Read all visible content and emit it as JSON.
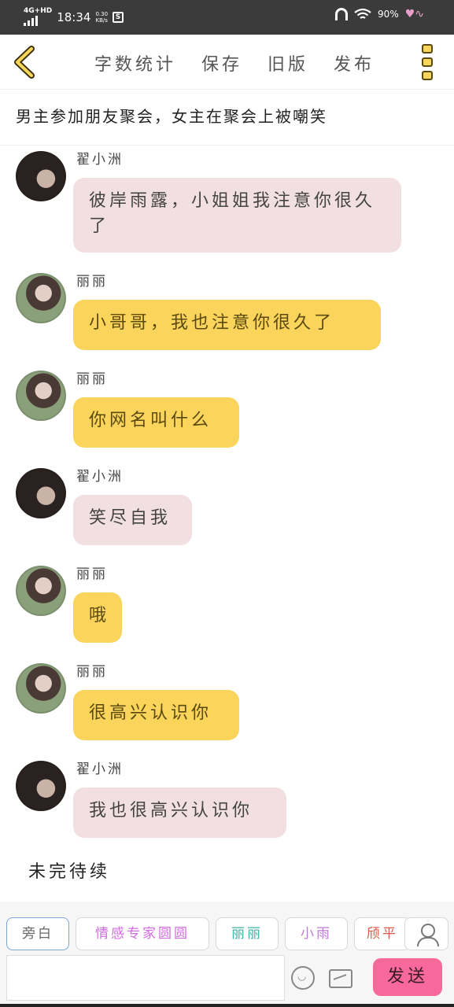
{
  "status_bar": {
    "network": "4G+HD",
    "time": "18:34",
    "speed_value": "0.30",
    "speed_unit": "KB/s",
    "app_glyph": "S",
    "battery": "90%"
  },
  "nav": {
    "items": [
      "字数统计",
      "保存",
      "旧版",
      "发布"
    ]
  },
  "story_title": "男主参加朋友聚会，女主在聚会上被嘲笑",
  "messages": [
    {
      "sender": "翟小洲",
      "text": "彼岸雨露，小姐姐我注意你很久了",
      "style": "pink",
      "avatar": "boy"
    },
    {
      "sender": "丽丽",
      "text": "小哥哥，我也注意你很久了",
      "style": "yellow",
      "avatar": "girl"
    },
    {
      "sender": "丽丽",
      "text": "你网名叫什么",
      "style": "yellow",
      "avatar": "girl"
    },
    {
      "sender": "翟小洲",
      "text": "笑尽自我",
      "style": "pink",
      "avatar": "boy"
    },
    {
      "sender": "丽丽",
      "text": "哦",
      "style": "yellow",
      "avatar": "girl"
    },
    {
      "sender": "丽丽",
      "text": "很高兴认识你",
      "style": "yellow",
      "avatar": "girl"
    },
    {
      "sender": "翟小洲",
      "text": "我也很高兴认识你",
      "style": "pink",
      "avatar": "boy"
    }
  ],
  "to_be_continued": "未完待续",
  "role_chips": [
    {
      "label": "旁白",
      "color": "#666666"
    },
    {
      "label": "情感专家圆圆",
      "color": "#d36be0"
    },
    {
      "label": "丽丽",
      "color": "#3fb3a8"
    },
    {
      "label": "小雨",
      "color": "#c07ad6"
    },
    {
      "label": "颀平",
      "color": "#e0584a"
    }
  ],
  "composer": {
    "input_value": "",
    "send_label": "发送"
  },
  "colors": {
    "pink_bubble": "#f2dfe1",
    "yellow_bubble": "#fbd45c",
    "send_button": "#f7699b",
    "accent_yellow": "#f7d65a"
  }
}
